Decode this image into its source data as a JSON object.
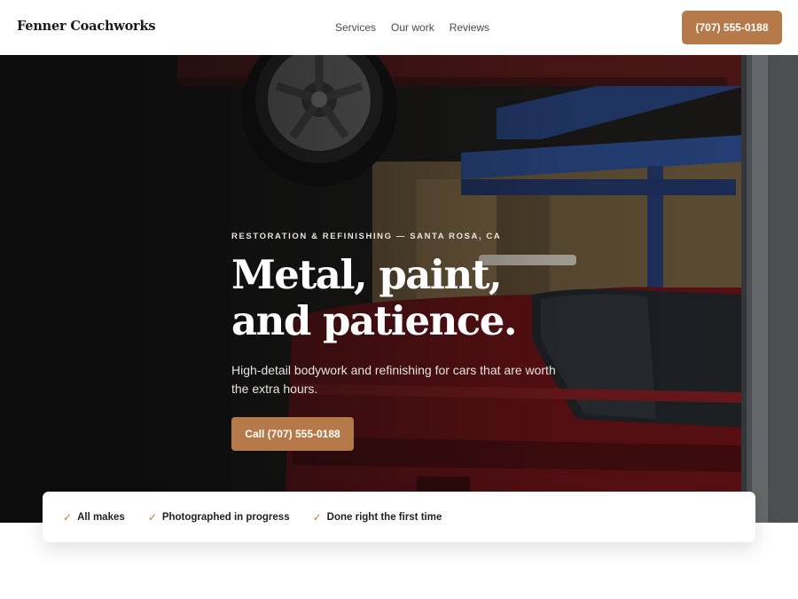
{
  "header": {
    "brand": "Fenner Coachworks",
    "nav": [
      "Services",
      "Our work",
      "Reviews"
    ],
    "cta_label": "(707) 555-0188"
  },
  "hero": {
    "eyebrow": "RESTORATION & REFINISHING — SANTA ROSA, CA",
    "title_lines": [
      "Metal, paint,",
      "and patience."
    ],
    "subtitle": "High-detail bodywork and refinishing for cars that are worth the extra hours.",
    "cta_label": "Call (707) 555-0188",
    "photo_icon": "garage-car-lift-photo"
  },
  "features": [
    "All makes",
    "Photographed in progress",
    "Done right the first time"
  ],
  "colors": {
    "accent": "#b67a4a",
    "header_bg": "#ffffff",
    "hero_text": "#ffffff"
  }
}
